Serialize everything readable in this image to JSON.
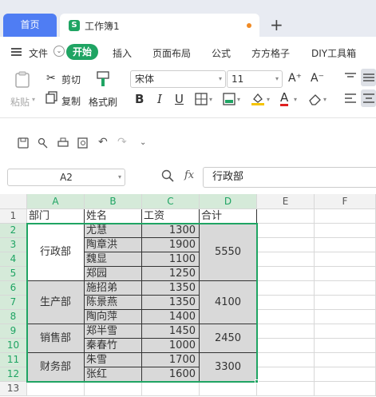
{
  "tabs": {
    "home": "首页",
    "doc_icon": "S",
    "doc_title": "工作簿1",
    "add": "+"
  },
  "menu": {
    "file": "文件",
    "start": "开始",
    "insert": "插入",
    "layout": "页面布局",
    "formula": "公式",
    "grid": "方方格子",
    "diy": "DIY工具箱"
  },
  "ribbon": {
    "paste": "粘贴",
    "cut": "剪切",
    "copy": "复制",
    "format_painter": "格式刷",
    "font": "宋体",
    "size": "11",
    "bold": "B",
    "italic": "I",
    "underline": "U",
    "grow": "A⁺",
    "shrink": "A⁻",
    "fontcolor": "A"
  },
  "formula_bar": {
    "cell_ref": "A2",
    "fx": "fx",
    "value": "行政部"
  },
  "columns": [
    "A",
    "B",
    "C",
    "D",
    "E",
    "F"
  ],
  "rows": [
    "1",
    "2",
    "3",
    "4",
    "5",
    "6",
    "7",
    "8",
    "9",
    "10",
    "11",
    "12",
    "13"
  ],
  "header_row": [
    "部门",
    "姓名",
    "工资",
    "合计"
  ],
  "departments": [
    "行政部",
    "生产部",
    "销售部",
    "财务部"
  ],
  "names": [
    "尤慧",
    "陶章洪",
    "魏显",
    "郑园",
    "施招弟",
    "陈景燕",
    "陶向萍",
    "郑半雪",
    "秦春竹",
    "朱雪",
    "张红"
  ],
  "salaries": [
    "1300",
    "1900",
    "1100",
    "1250",
    "1350",
    "1350",
    "1400",
    "1450",
    "1000",
    "1700",
    "1600"
  ],
  "totals": [
    "5550",
    "4100",
    "2450",
    "3300"
  ],
  "colors": {
    "accent": "#1fa463",
    "tab_blue": "#4f7df3",
    "selection": "#d9d9d9"
  }
}
